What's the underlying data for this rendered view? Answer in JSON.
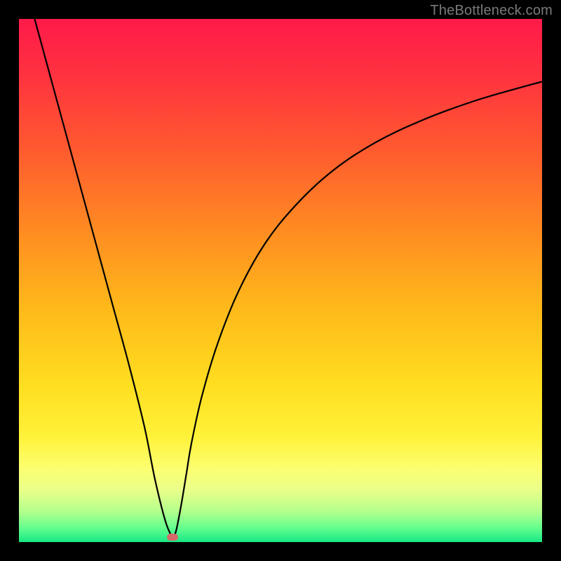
{
  "watermark": "TheBottleneck.com",
  "colors": {
    "frame": "#000000",
    "curve_stroke": "#000000",
    "marker_fill": "#d66a6a",
    "gradient_stops": [
      {
        "offset": 0.0,
        "color": "#ff1a4a"
      },
      {
        "offset": 0.1,
        "color": "#ff3040"
      },
      {
        "offset": 0.25,
        "color": "#ff5a2f"
      },
      {
        "offset": 0.4,
        "color": "#ff8a22"
      },
      {
        "offset": 0.55,
        "color": "#ffb81a"
      },
      {
        "offset": 0.7,
        "color": "#ffde20"
      },
      {
        "offset": 0.8,
        "color": "#fff23a"
      },
      {
        "offset": 0.86,
        "color": "#fbff70"
      },
      {
        "offset": 0.9,
        "color": "#eaff8a"
      },
      {
        "offset": 0.94,
        "color": "#b6ff8c"
      },
      {
        "offset": 0.97,
        "color": "#6cff8f"
      },
      {
        "offset": 1.0,
        "color": "#17e885"
      }
    ]
  },
  "chart_data": {
    "type": "line",
    "title": "",
    "xlabel": "",
    "ylabel": "",
    "xlim": [
      0,
      100
    ],
    "ylim": [
      0,
      100
    ],
    "grid": false,
    "legend": false,
    "series": [
      {
        "name": "bottleneck-curve",
        "x": [
          3,
          6,
          9,
          12,
          15,
          18,
          21,
          24,
          26,
          28,
          29.3,
          30,
          31,
          32,
          33,
          35,
          38,
          42,
          47,
          53,
          60,
          68,
          77,
          87,
          97,
          100
        ],
        "y": [
          100,
          89,
          78,
          67,
          56,
          45,
          34,
          22,
          12,
          4,
          0.9,
          2,
          7,
          13,
          19,
          28,
          38,
          48,
          57,
          64.5,
          71,
          76.3,
          80.6,
          84.3,
          87.2,
          88
        ]
      }
    ],
    "marker": {
      "x": 29.3,
      "y": 0.9,
      "shape": "rounded-rect"
    },
    "notes": "V-shaped bottleneck curve over red→yellow→green vertical gradient. Minimum near x≈29% (the bottleneck point). Values are visual estimates from an unlabeled chart."
  }
}
